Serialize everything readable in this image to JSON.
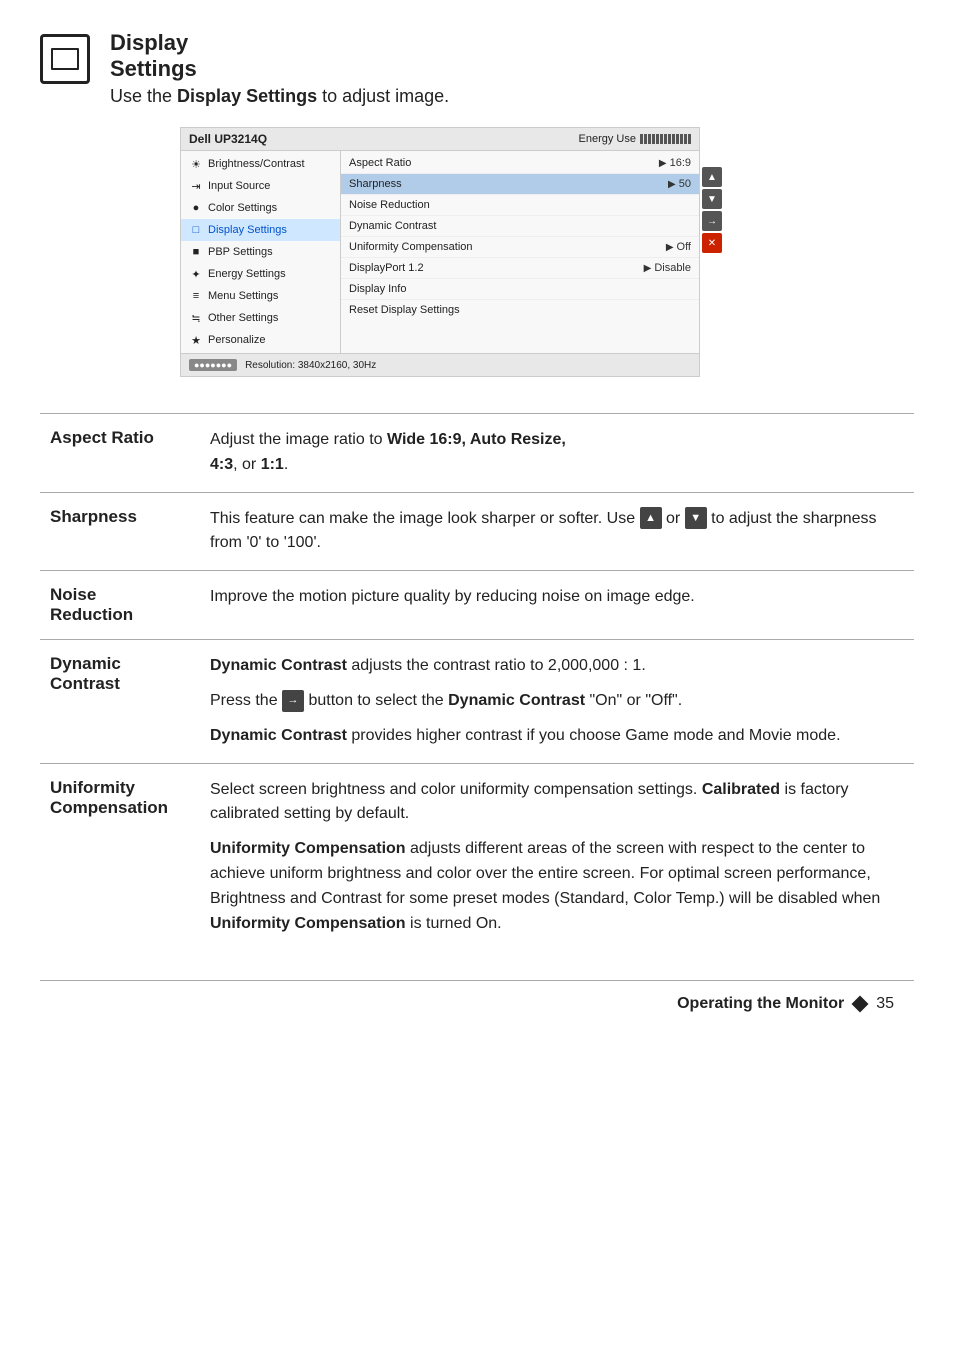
{
  "header": {
    "title_line1": "Display",
    "title_line2": "Settings",
    "description": "Use the ",
    "description_bold": "Display Settings",
    "description_rest": " to adjust image."
  },
  "osd": {
    "monitor_name": "Dell UP3214Q",
    "energy_label": "Energy Use",
    "menu_items": [
      {
        "id": "brightness",
        "label": "Brightness/Contrast",
        "icon": "☀"
      },
      {
        "id": "input",
        "label": "Input Source",
        "icon": "⇥"
      },
      {
        "id": "color",
        "label": "Color Settings",
        "icon": "●"
      },
      {
        "id": "display",
        "label": "Display Settings",
        "icon": "□",
        "active": true
      },
      {
        "id": "pbp",
        "label": "PBP Settings",
        "icon": "■"
      },
      {
        "id": "energy",
        "label": "Energy Settings",
        "icon": "✦"
      },
      {
        "id": "menu",
        "label": "Menu Settings",
        "icon": "≡"
      },
      {
        "id": "other",
        "label": "Other Settings",
        "icon": "≒"
      },
      {
        "id": "personalize",
        "label": "Personalize",
        "icon": "★"
      }
    ],
    "submenu_items": [
      {
        "label": "Aspect Ratio",
        "value": "16:9",
        "highlighted": false
      },
      {
        "label": "Sharpness",
        "value": "50",
        "highlighted": true
      },
      {
        "label": "Noise Reduction",
        "value": "",
        "highlighted": false
      },
      {
        "label": "Dynamic Contrast",
        "value": "",
        "highlighted": false
      },
      {
        "label": "Uniformity Compensation",
        "value": "Off",
        "highlighted": false
      },
      {
        "label": "DisplayPort 1.2",
        "value": "Disable",
        "highlighted": false
      },
      {
        "label": "Display Info",
        "value": "",
        "highlighted": false
      },
      {
        "label": "Reset Display Settings",
        "value": "",
        "highlighted": false
      }
    ],
    "footer_connector": "●●●●●●●",
    "footer_resolution": "Resolution: 3840x2160, 30Hz",
    "nav_buttons": [
      "▲",
      "▼",
      "→",
      "✕"
    ]
  },
  "entries": [
    {
      "term": "Aspect Ratio",
      "desc_parts": [
        {
          "type": "mixed",
          "text": "Adjust the image ratio to ",
          "bold": "Wide 16:9, Auto Resize,",
          "rest": " 4:3, or 1:1."
        }
      ]
    },
    {
      "term": "Sharpness",
      "desc_parts": [
        {
          "type": "text",
          "text": "This feature can make the image look sharper or softer. Use ▲ or ▼ to adjust the sharpness from '0' to '100'."
        }
      ]
    },
    {
      "term_line1": "Noise",
      "term_line2": "Reduction",
      "desc_parts": [
        {
          "type": "text",
          "text": "Improve the motion picture quality by reducing noise on image edge."
        }
      ]
    },
    {
      "term_line1": "Dynamic",
      "term_line2": "Contrast",
      "desc_parts": [
        {
          "type": "p",
          "bold": "Dynamic Contrast",
          "rest": " adjusts the contrast ratio to 2,000,000 : 1."
        },
        {
          "type": "p",
          "text_before": "Press the ",
          "icon": "→",
          "text_after": " button to select the ",
          "bold": "Dynamic Contrast",
          "rest": " \"On\" or \"Off\"."
        },
        {
          "type": "p",
          "bold": "Dynamic Contrast",
          "rest": " provides higher contrast if you choose Game mode and Movie mode."
        }
      ]
    },
    {
      "term_line1": "Uniformity",
      "term_line2": "Compensation",
      "desc_parts": [
        {
          "type": "p",
          "text": "Select screen brightness and color uniformity compensation settings. ",
          "bold_inline": "Calibrated",
          "rest": " is factory calibrated setting by default."
        },
        {
          "type": "p",
          "bold": "Uniformity Compensation",
          "rest": " adjusts different areas of the screen with respect to the center to achieve uniform brightness and color over the entire screen. For optimal screen performance, Brightness and Contrast for some preset modes (Standard, Color Temp.) will be disabled when ",
          "bold_end": "Uniformity Compensation",
          "rest_end": " is turned On."
        }
      ]
    }
  ],
  "footer": {
    "text": "Operating the Monitor",
    "page": "35"
  }
}
